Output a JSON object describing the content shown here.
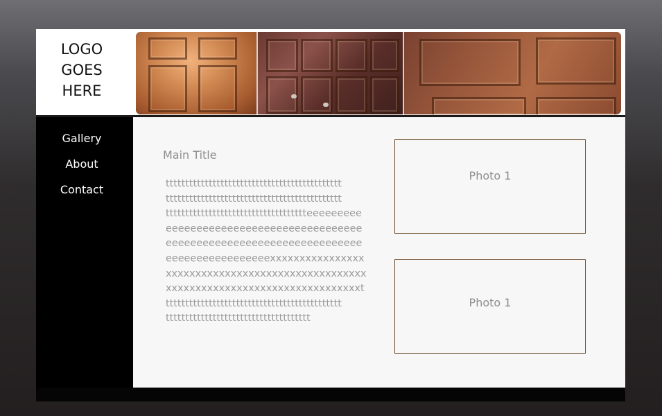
{
  "logo": {
    "lines": [
      "LOGO",
      "GOES",
      "HERE"
    ]
  },
  "nav": {
    "items": [
      "Gallery",
      "About",
      "Contact"
    ]
  },
  "main": {
    "title": "Main Title",
    "body_lines": [
      "ttttttttttttttttttttttttttttttttttttttttttttt",
      "ttttttttttttttttttttttttttttttttttttttttttttt",
      "tttttttttttttttttttttttttttttttttttteeeeeeeee",
      "eeeeeeeeeeeeeeeeeeeeeeeeeeeeeeee",
      "eeeeeeeeeeeeeeeeeeeeeeeeeeeeeeee",
      "eeeeeeeeeeeeeeeeexxxxxxxxxxxxxxxx",
      "xxxxxxxxxxxxxxxxxxxxxxxxxxxxxxxxxx",
      "xxxxxxxxxxxxxxxxxxxxxxxxxxxxxxxxxt",
      "ttttttttttttttttttttttttttttttttttttttttttttt",
      "ttttttttttttttttttttttttttttttttttttt"
    ]
  },
  "photos": [
    "Photo 1",
    "Photo 1"
  ],
  "colors": {
    "header_bg": "#ffffff",
    "sidebar_bg": "#000000",
    "content_bg": "#f8f7f7",
    "photo_border": "#6b4a2b",
    "muted_text": "#8d8d8d"
  },
  "banner": {
    "panels": [
      "wood-door-panel",
      "wood-door-panel-dark",
      "wood-ceiling-panel"
    ]
  }
}
